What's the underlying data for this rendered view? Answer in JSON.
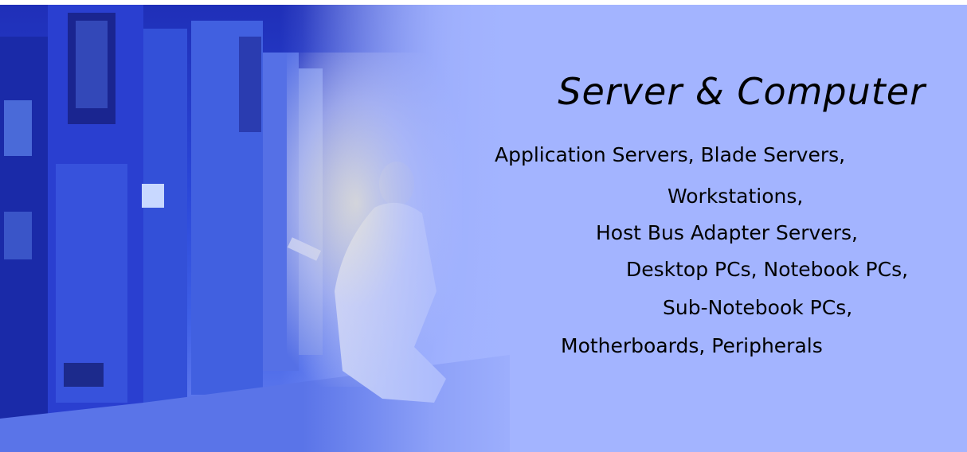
{
  "banner": {
    "title": "Server & Computer",
    "lines": [
      "Application Servers, Blade Servers,",
      "Workstations,",
      "Host Bus Adapter Servers,",
      "Desktop PCs, Notebook PCs,",
      "Sub-Notebook PCs,",
      "Motherboards, Peripherals"
    ],
    "background_color": "#a3b4ff",
    "text_color": "#000000"
  }
}
